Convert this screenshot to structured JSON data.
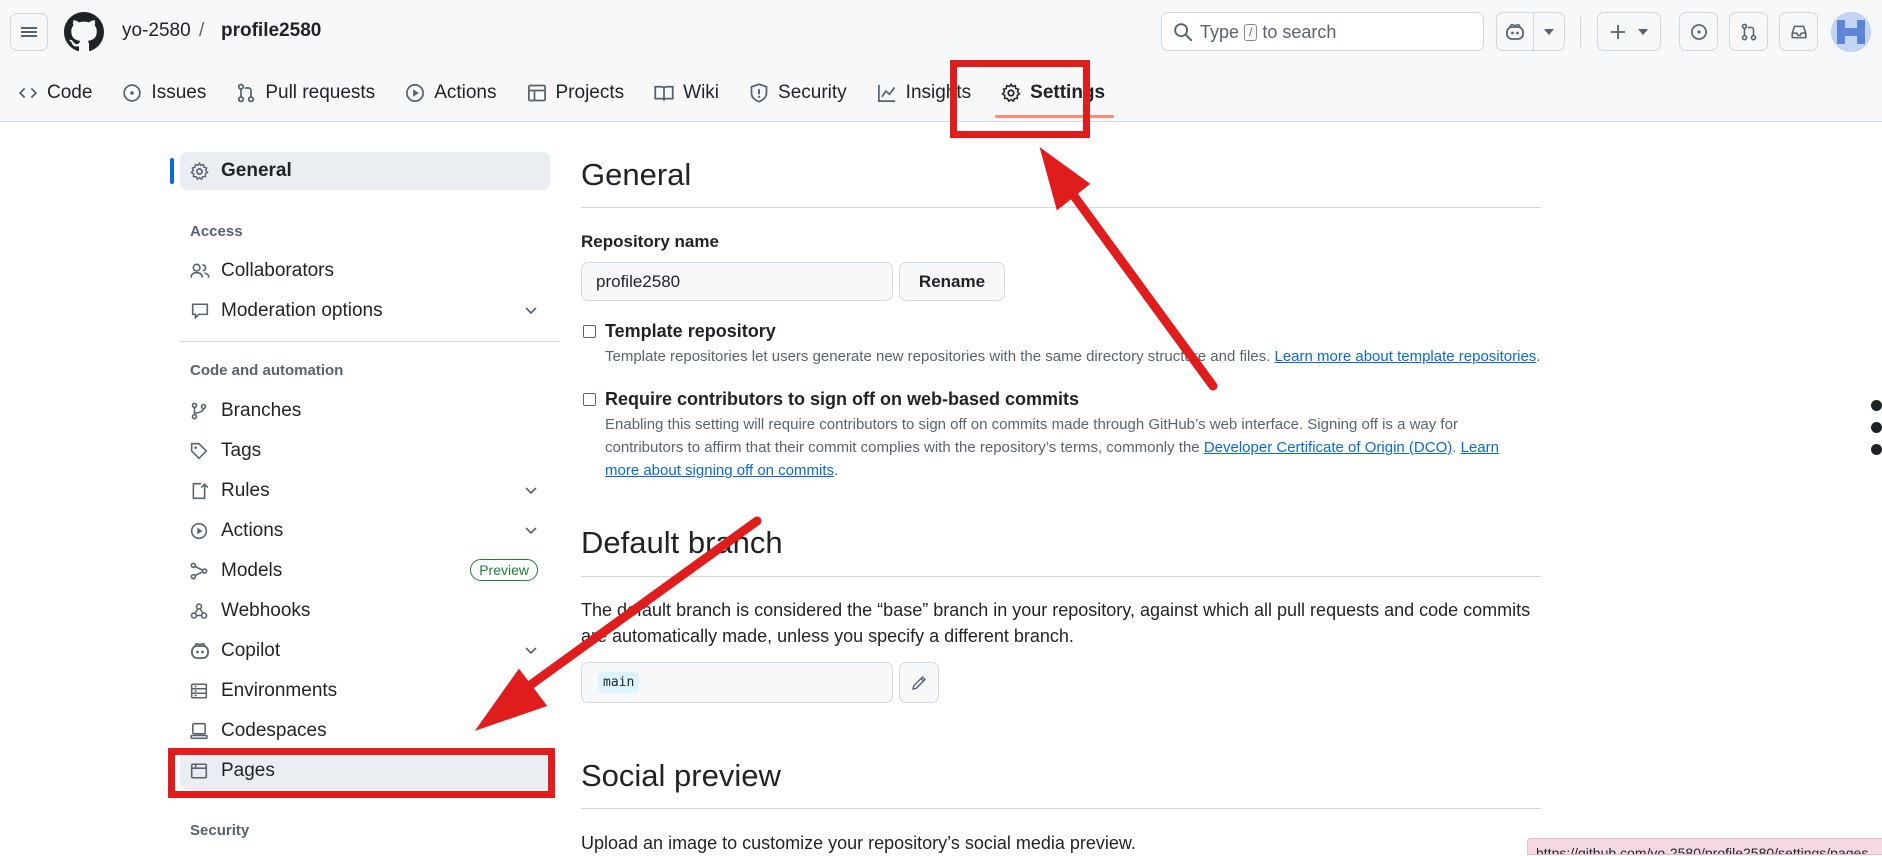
{
  "header": {
    "owner": "yo-2580",
    "separator": "/",
    "repo": "profile2580",
    "search_prefix": "Type",
    "search_key": "/",
    "search_suffix": "to search"
  },
  "tabs": [
    {
      "label": "Code",
      "icon": "code-icon"
    },
    {
      "label": "Issues",
      "icon": "issue-icon"
    },
    {
      "label": "Pull requests",
      "icon": "pull-request-icon"
    },
    {
      "label": "Actions",
      "icon": "play-icon"
    },
    {
      "label": "Projects",
      "icon": "table-icon"
    },
    {
      "label": "Wiki",
      "icon": "book-icon"
    },
    {
      "label": "Security",
      "icon": "shield-icon"
    },
    {
      "label": "Insights",
      "icon": "graph-icon"
    },
    {
      "label": "Settings",
      "icon": "gear-icon",
      "selected": true
    }
  ],
  "sidebar": {
    "general": "General",
    "access_heading": "Access",
    "collaborators": "Collaborators",
    "moderation": "Moderation options",
    "code_heading": "Code and automation",
    "branches": "Branches",
    "tags": "Tags",
    "rules": "Rules",
    "actions": "Actions",
    "models": "Models",
    "models_badge": "Preview",
    "webhooks": "Webhooks",
    "copilot": "Copilot",
    "environments": "Environments",
    "codespaces": "Codespaces",
    "pages": "Pages",
    "security_heading": "Security"
  },
  "main": {
    "general_title": "General",
    "repo_name_label": "Repository name",
    "repo_name_value": "profile2580",
    "rename_button": "Rename",
    "template_title": "Template repository",
    "template_desc": "Template repositories let users generate new repositories with the same directory structure and files.",
    "template_link": "Learn more about template repositories",
    "signoff_title": "Require contributors to sign off on web-based commits",
    "signoff_desc_1": "Enabling this setting will require contributors to sign off on commits made through GitHub’s web interface. Signing off is a way for",
    "signoff_desc_2": "contributors to affirm that their commit complies with the repository’s terms, commonly the",
    "signoff_link_dco": "Developer Certificate of Origin (DCO)",
    "signoff_link_learn_1": "Learn",
    "signoff_link_learn_2": "more about signing off on commits",
    "default_branch_title": "Default branch",
    "default_branch_desc": "The default branch is considered the “base” branch in your repository, against which all pull requests and code commits are automatically made, unless you specify a different branch.",
    "default_branch_value": "main",
    "social_title": "Social preview",
    "social_desc": "Upload an image to customize your repository’s social media preview."
  },
  "statusbar": "https://github.com/yo-2580/profile2580/settings/pages",
  "colors": {
    "highlight": "#e11c1c",
    "accent": "#0969da",
    "selected_underline": "#fd8c73",
    "badge_green": "#1a7f37"
  }
}
